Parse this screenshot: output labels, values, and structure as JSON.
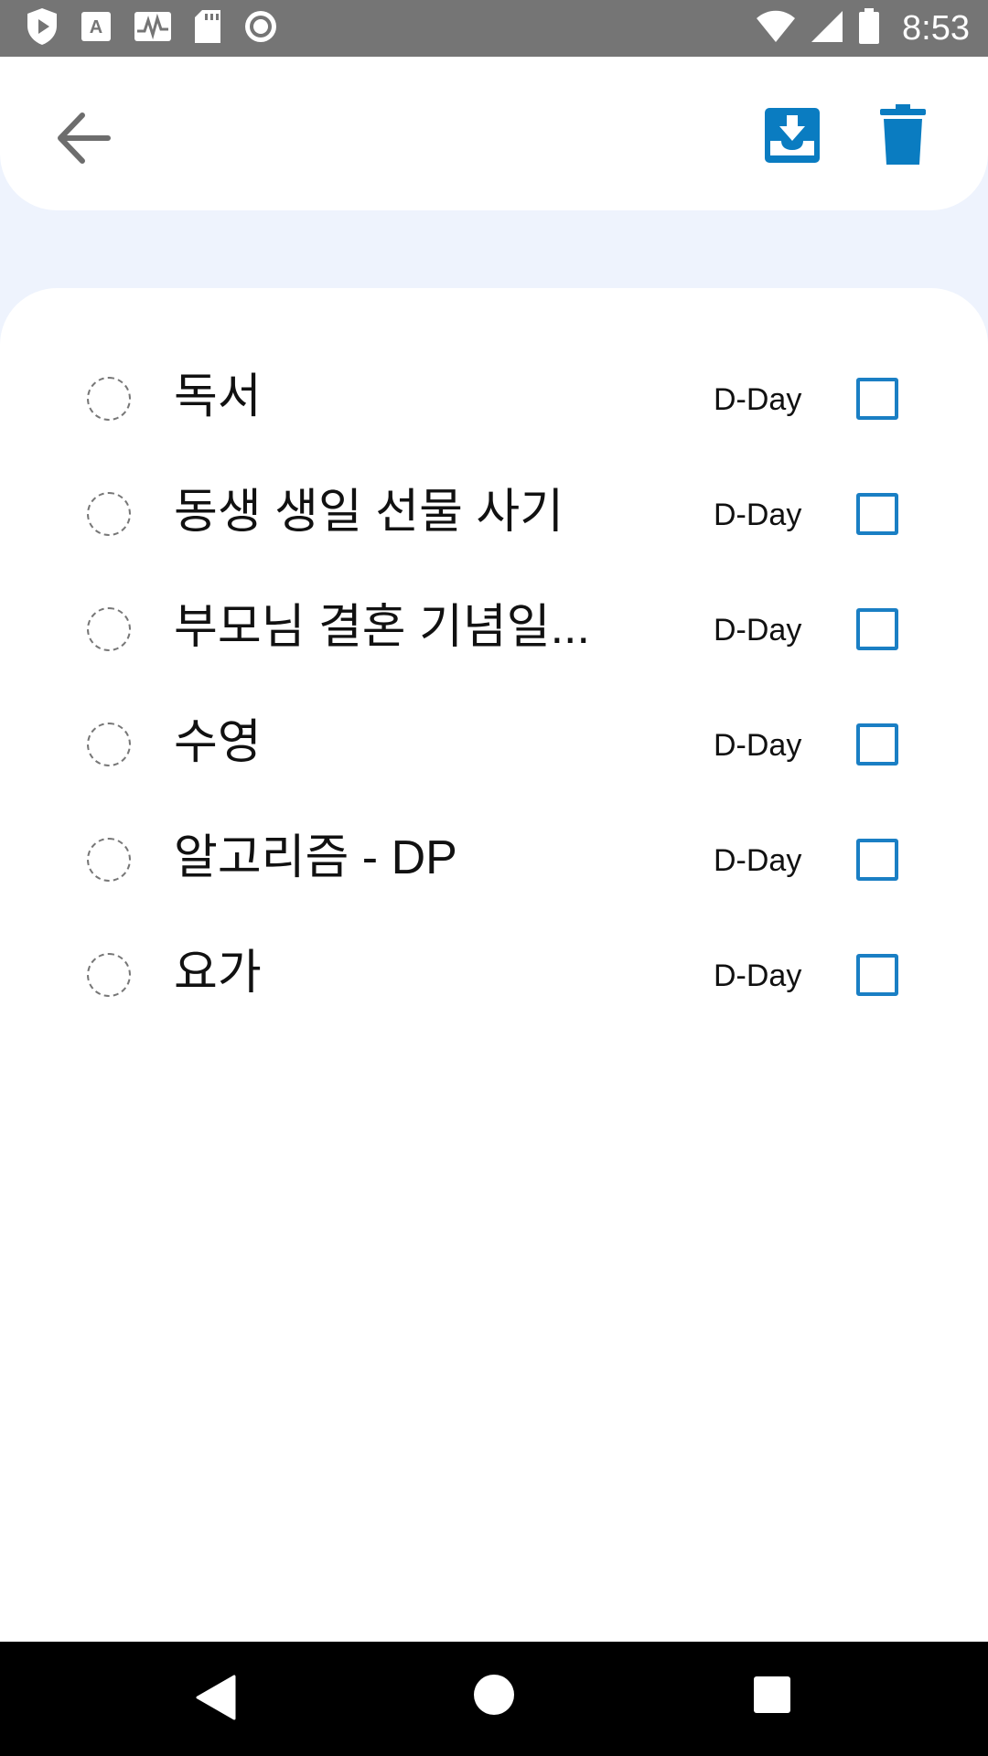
{
  "status_bar": {
    "time": "8:53",
    "left_icons": [
      "play-protect-icon",
      "font-icon",
      "activity-icon",
      "sd-card-icon",
      "record-icon"
    ],
    "right_icons": [
      "wifi-icon",
      "signal-icon",
      "battery-icon"
    ]
  },
  "app_bar": {
    "icons": [
      "back-arrow-icon",
      "archive-download-icon",
      "trash-icon"
    ],
    "accent_color": "#0a7cc1"
  },
  "tasks": [
    {
      "title": "독서",
      "due": "D-Day",
      "checked": false
    },
    {
      "title": "동생 생일 선물 사기",
      "due": "D-Day",
      "checked": false
    },
    {
      "title": "부모님 결혼 기념일...",
      "due": "D-Day",
      "checked": false
    },
    {
      "title": "수영",
      "due": "D-Day",
      "checked": false
    },
    {
      "title": "알고리즘 - DP",
      "due": "D-Day",
      "checked": false
    },
    {
      "title": "요가",
      "due": "D-Day",
      "checked": false
    }
  ],
  "nav_bar": {
    "icons": [
      "nav-back-icon",
      "nav-home-icon",
      "nav-recents-icon"
    ]
  }
}
